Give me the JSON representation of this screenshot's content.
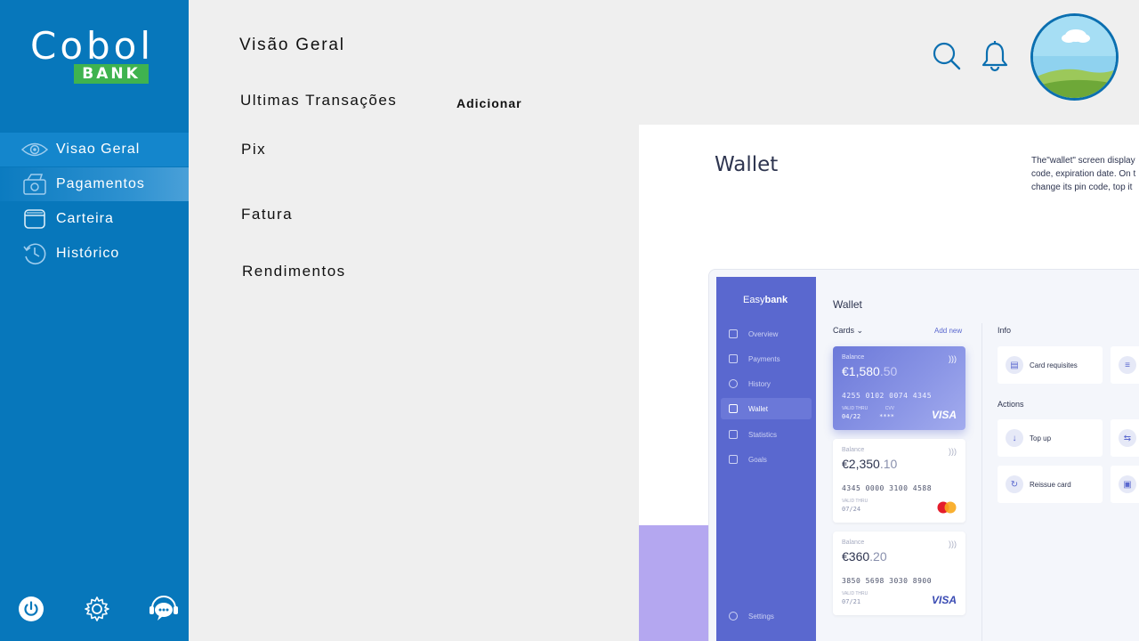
{
  "brand": {
    "name": "Cobol",
    "badge": "BANK"
  },
  "sidebar": {
    "items": [
      {
        "label": "Visao Geral",
        "icon": "eye-icon"
      },
      {
        "label": "Pagamentos",
        "icon": "money-icon"
      },
      {
        "label": "Carteira",
        "icon": "wallet-icon"
      },
      {
        "label": "Histórico",
        "icon": "history-icon"
      }
    ],
    "bottom": [
      {
        "icon": "power-icon"
      },
      {
        "icon": "gear-icon"
      },
      {
        "icon": "support-chat-icon"
      }
    ]
  },
  "main": {
    "title": "Visão Geral",
    "menu": [
      "Ultimas Transações",
      "Pix",
      "Fatura",
      "Rendimentos"
    ],
    "add_label": "Adicionar"
  },
  "header": {
    "icons": [
      "search-icon",
      "bell-icon"
    ],
    "avatar": "user-avatar"
  },
  "preview": {
    "title": "Wallet",
    "description_lines": [
      "The\"wallet\" screen display",
      "code, expiration date. On t",
      "change its pin code, top it"
    ],
    "app": {
      "brand_light": "Easy",
      "brand_bold": "bank",
      "nav": [
        "Overview",
        "Payments",
        "History",
        "Wallet",
        "Statistics",
        "Goals"
      ],
      "nav_bottom": "Settings",
      "main_title": "Wallet",
      "cards_label": "Cards",
      "add_new": "Add new",
      "balance_label": "Balance",
      "valid_label": "VALID THRU",
      "cvv_label": "CVV",
      "cards": [
        {
          "whole": "€1,580",
          "cents": ".50",
          "number": "4255 0102 0074 4345",
          "expiry": "04/22",
          "cvv": "****",
          "brand": "VISA"
        },
        {
          "whole": "€2,350",
          "cents": ".10",
          "number": "4345 0000 3100 4588",
          "expiry": "07/24",
          "brand": "mastercard"
        },
        {
          "whole": "€360",
          "cents": ".20",
          "number": "3850 5698 3030 8900",
          "expiry": "07/21",
          "brand": "VISA"
        }
      ],
      "info_label": "Info",
      "actions_label": "Actions",
      "info_tiles": [
        "Card requisites"
      ],
      "action_tiles": [
        "Top up",
        "Reissue card"
      ]
    }
  },
  "colors": {
    "sidebar": "#0777bb",
    "active_item": "#1486cc",
    "badge": "#3fb34f",
    "accent": "#5a68cf"
  }
}
